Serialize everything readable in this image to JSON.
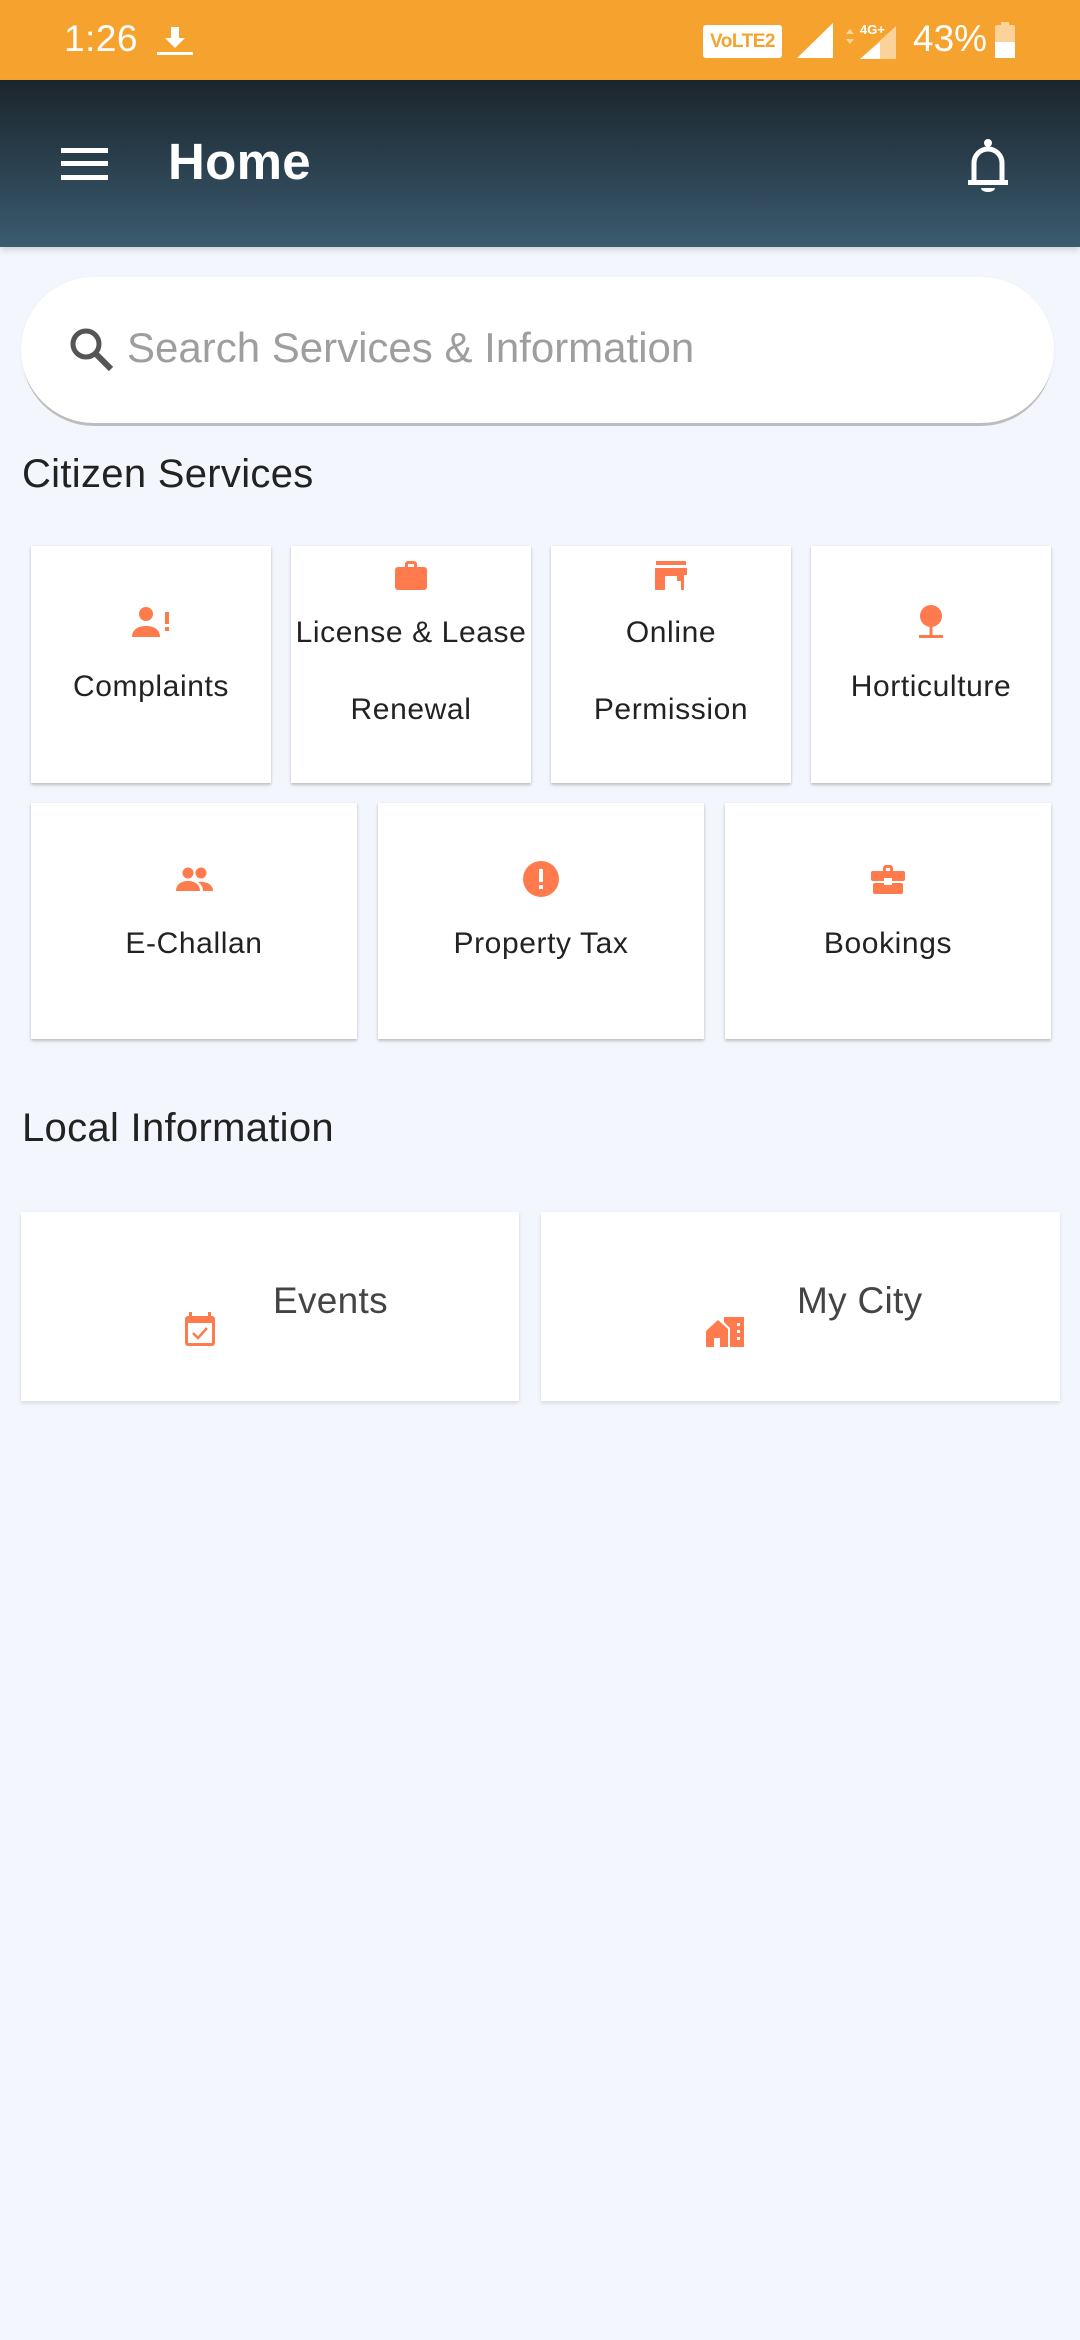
{
  "status_bar": {
    "time": "1:26",
    "network_badge": "VoLTE2",
    "network_type": "4G+",
    "battery_percent": "43%",
    "battery_level": 0.43,
    "bg_color": "#F5A32E"
  },
  "app_bar": {
    "title": "Home",
    "menu_icon": "hamburger-menu-icon",
    "notification_icon": "bell-icon"
  },
  "search": {
    "placeholder": "Search Services & Information",
    "value": ""
  },
  "citizen_services": {
    "title": "Citizen Services",
    "items": [
      {
        "label": "Complaints",
        "icon": "person-alert-icon"
      },
      {
        "label": "License & Lease Renewal",
        "icon": "briefcase-icon"
      },
      {
        "label": "Online Permission",
        "icon": "store-icon"
      },
      {
        "label": "Horticulture",
        "icon": "tree-icon"
      },
      {
        "label": "E-Challan",
        "icon": "people-icon"
      },
      {
        "label": "Property Tax",
        "icon": "alert-circle-icon"
      },
      {
        "label": "Bookings",
        "icon": "business-center-icon"
      }
    ]
  },
  "local_information": {
    "title": "Local Information",
    "items": [
      {
        "label": "Events",
        "icon": "calendar-check-icon"
      },
      {
        "label": "My City",
        "icon": "city-icon"
      }
    ]
  },
  "colors": {
    "accent": "#FF7A4D",
    "background": "#F3F6FC",
    "appbar_top": "#1B252D",
    "appbar_bottom": "#3A5B6F"
  }
}
